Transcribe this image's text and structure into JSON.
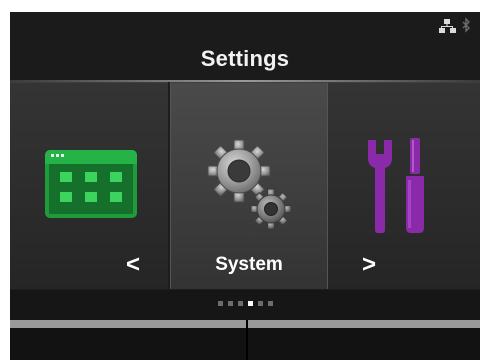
{
  "header": {
    "title": "Settings",
    "status_icons": [
      "network-icon",
      "bluetooth-icon"
    ]
  },
  "menu": {
    "items": [
      {
        "icon": "calendar-grid-icon",
        "label": "",
        "color": "#1e9c3c"
      },
      {
        "icon": "gears-icon",
        "label": "System",
        "color": "#8a8a8a"
      },
      {
        "icon": "tools-icon",
        "label": "",
        "color": "#8b2aa8"
      }
    ],
    "selected_index": 1,
    "prev_arrow": "<",
    "next_arrow": ">"
  },
  "pagination": {
    "total": 6,
    "current": 4
  },
  "colors": {
    "background": "#161616",
    "accent_green": "#1e9c3c",
    "accent_purple": "#8b2aa8",
    "text": "#ffffff"
  }
}
